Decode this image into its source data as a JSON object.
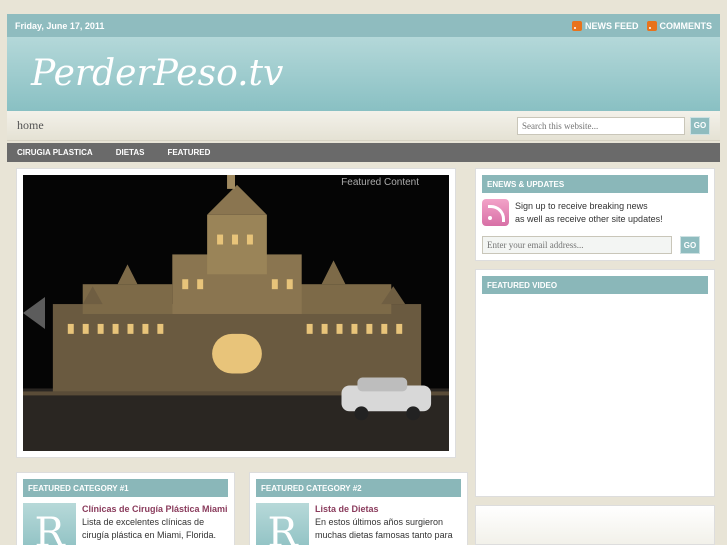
{
  "topbar": {
    "date": "Friday, June 17, 2011",
    "news_feed": "NEWS FEED",
    "comments": "COMMENTS"
  },
  "header": {
    "logo": "PerderPeso.tv"
  },
  "nav": {
    "home": "home",
    "search_placeholder": "Search this website...",
    "go": "GO",
    "items": [
      "CIRUGIA PLASTICA",
      "DIETAS",
      "FEATURED"
    ]
  },
  "slider": {
    "label": "Featured Content"
  },
  "categories": [
    {
      "heading": "FEATURED CATEGORY #1",
      "thumb_letter": "R",
      "title": "Clínicas de Cirugía Plástica Miami",
      "text": "Lista de excelentes clínicas de cirugía plástica en Miami, Florida."
    },
    {
      "heading": "FEATURED CATEGORY #2",
      "thumb_letter": "R",
      "title": "Lista de Dietas",
      "text": "En estos últimos años surgieron muchas dietas famosas tanto para"
    }
  ],
  "sidebar": {
    "enews_heading": "ENEWS & UPDATES",
    "enews_line1": "Sign up to receive breaking news",
    "enews_line2": "as well as receive other site updates!",
    "email_placeholder": "Enter your email address...",
    "go": "GO",
    "video_heading": "FEATURED VIDEO"
  },
  "colors": {
    "accent": "#8ab7b9",
    "nav_dark": "#6a6a6a",
    "link": "#8a3b5c"
  }
}
